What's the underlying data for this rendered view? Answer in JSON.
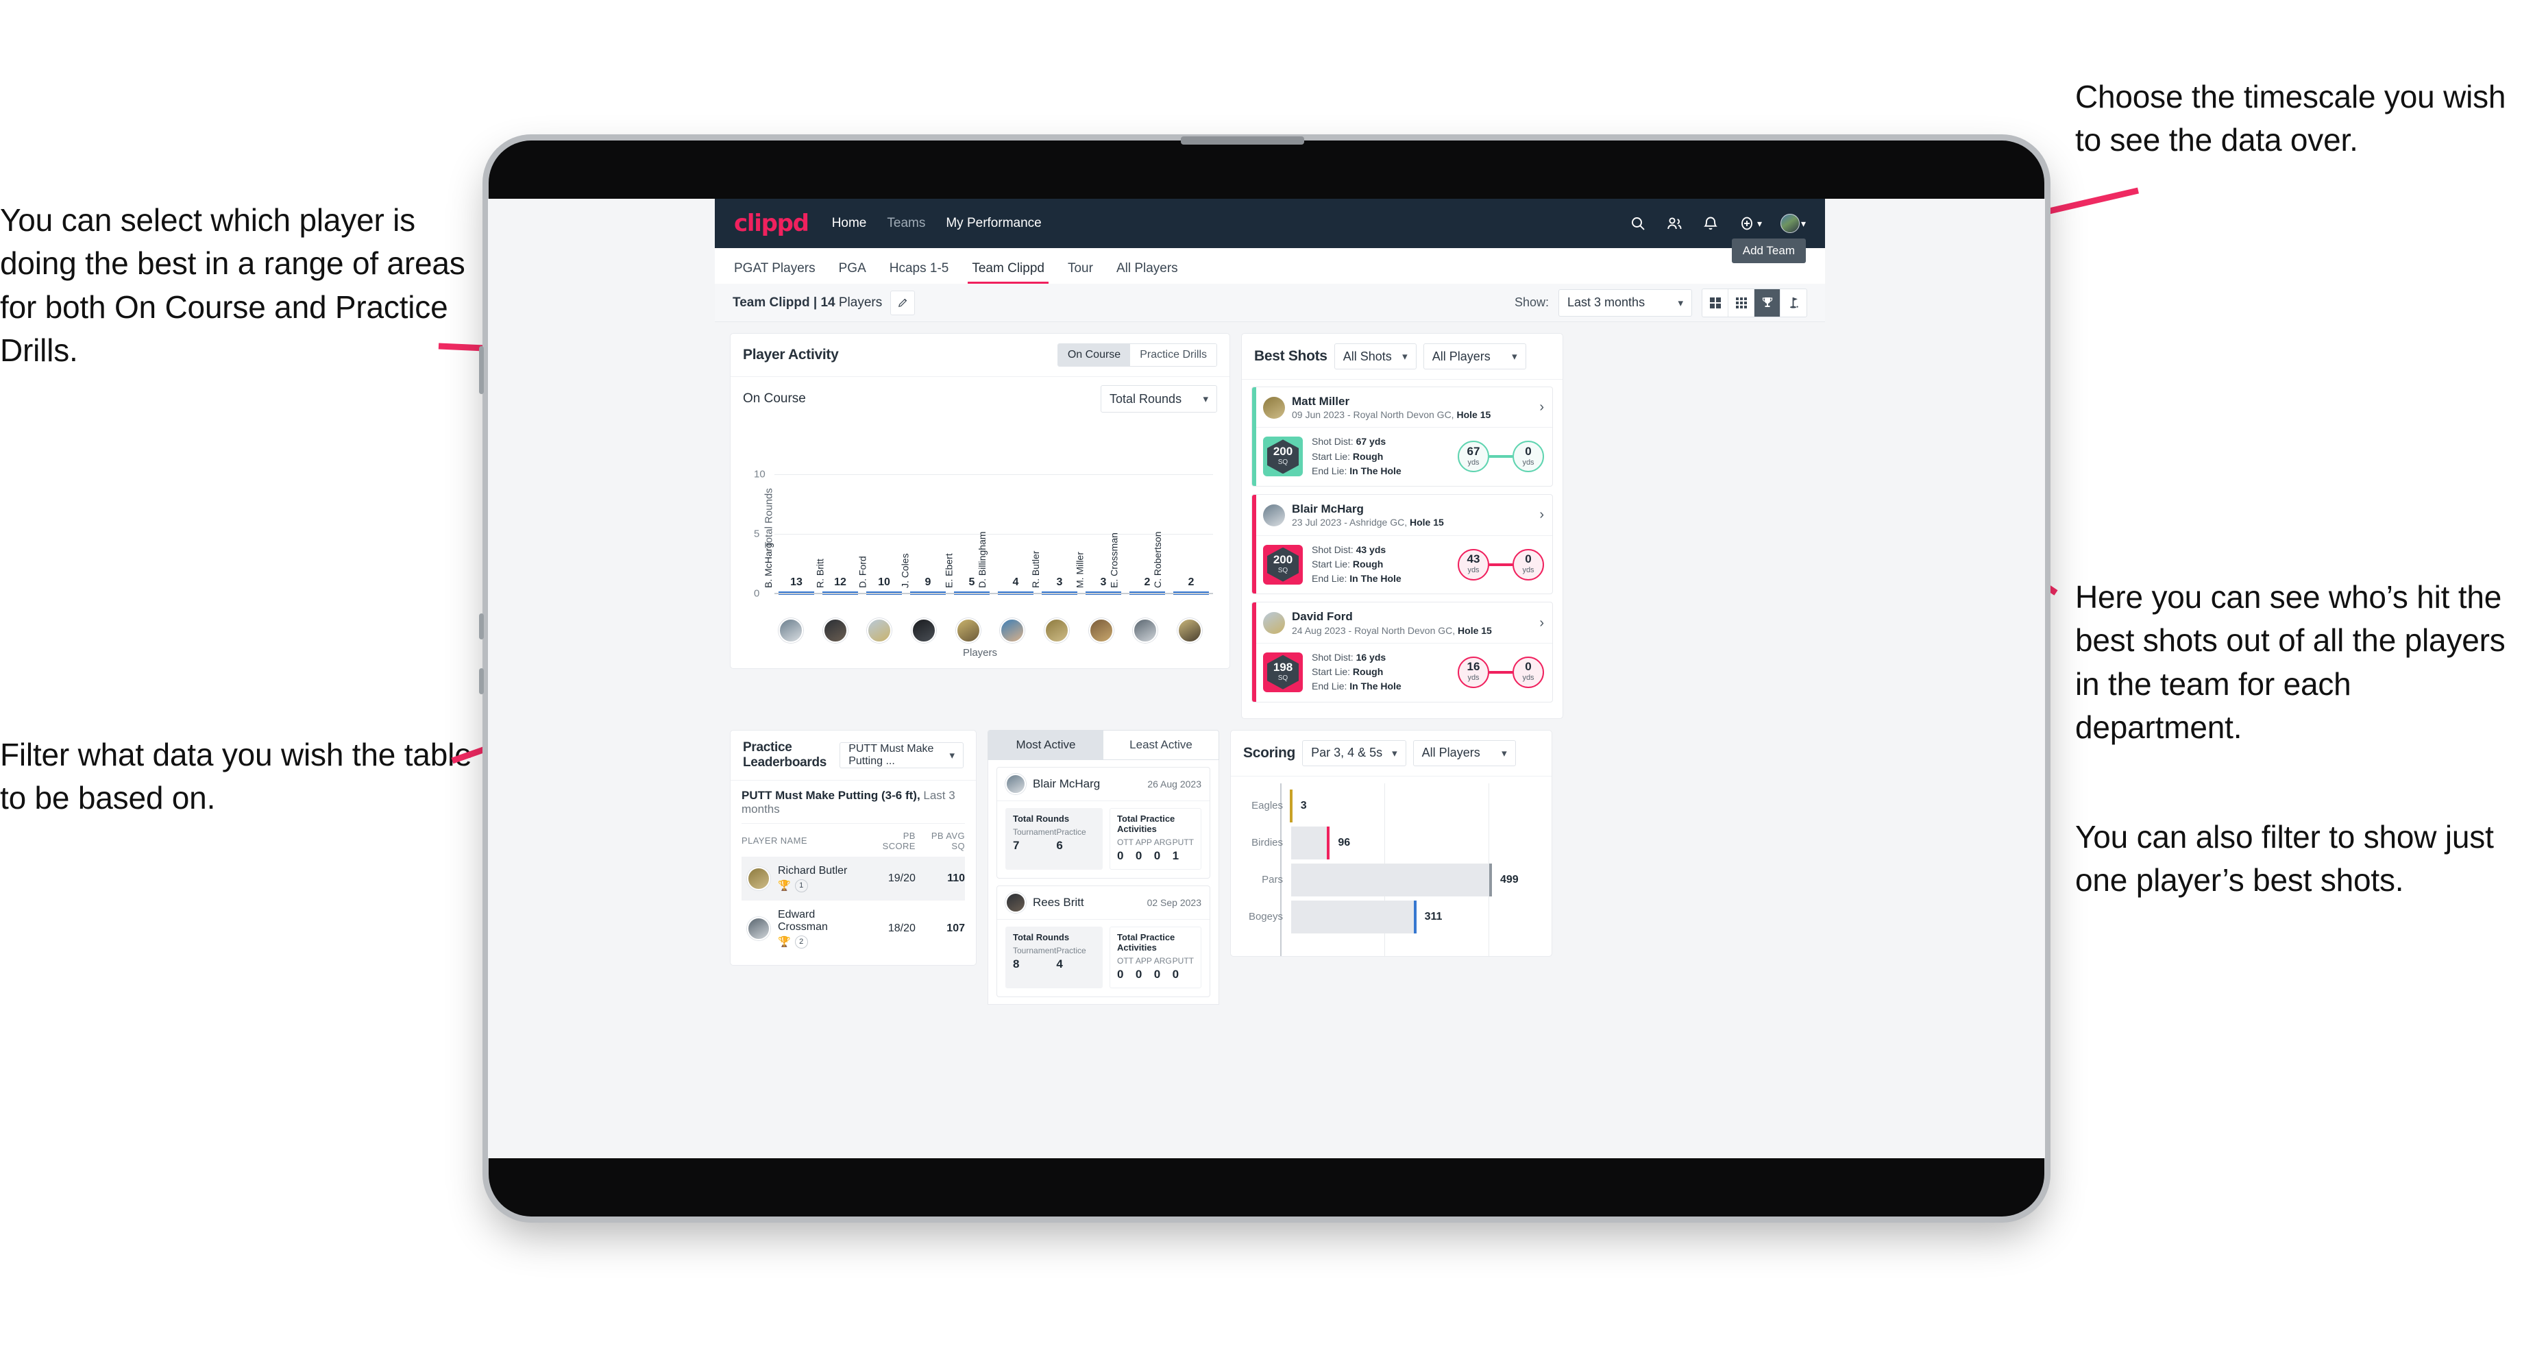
{
  "annotations": {
    "left_top": "You can select which player is doing the best in a range of areas for both On Course and Practice Drills.",
    "left_bottom": "Filter what data you wish the table to be based on.",
    "right_top": "Choose the timescale you wish to see the data over.",
    "right_mid": "Here you can see who’s hit the best shots out of all the players in the team for each department.",
    "right_bottom": "You can also filter to show just one player’s best shots."
  },
  "topnav": {
    "brand": "clippd",
    "links": [
      "Home",
      "Teams",
      "My Performance"
    ],
    "icons": [
      "search-icon",
      "people-icon",
      "bell-icon",
      "plus-circle-icon",
      "avatar"
    ]
  },
  "tabs": {
    "items": [
      "PGAT Players",
      "PGA",
      "Hcaps 1-5",
      "Team Clippd",
      "Tour",
      "All Players"
    ],
    "active": "Team Clippd",
    "add_team_label": "Add Team"
  },
  "subheader": {
    "team_label_bold": "Team Clippd | 14",
    "team_label_rest": " Players",
    "show_label": "Show:",
    "date_range": "Last 3 months",
    "view_buttons": [
      "grid-large-icon",
      "grid-small-icon",
      "trophy-icon",
      "flag-icon"
    ],
    "view_active_index": 2
  },
  "player_activity": {
    "title": "Player Activity",
    "segments": [
      "On Course",
      "Practice Drills"
    ],
    "segment_active": "On Course",
    "sub_label": "On Course",
    "metric": "Total Rounds"
  },
  "best_shots": {
    "title": "Best Shots",
    "filter_shots": "All Shots",
    "filter_players": "All Players",
    "cards": [
      {
        "name": "Matt Miller",
        "meta_plain": "09 Jun 2023 - Royal North Devon GC, ",
        "meta_bold": "Hole 15",
        "hex_num": "200",
        "hex_sub": "SQ",
        "accent": "#5fd4b0",
        "shot_dist_label": "Shot Dist: ",
        "shot_dist_value": "67 yds",
        "start_lie_label": "Start Lie: ",
        "start_lie_value": "Rough",
        "end_lie_label": "End Lie: ",
        "end_lie_value": "In The Hole",
        "from_value": "67",
        "from_unit": "yds",
        "to_value": "0",
        "to_unit": "yds"
      },
      {
        "name": "Blair McHarg",
        "meta_plain": "23 Jul 2023 - Ashridge GC, ",
        "meta_bold": "Hole 15",
        "hex_num": "200",
        "hex_sub": "SQ",
        "accent": "#f0215e",
        "shot_dist_label": "Shot Dist: ",
        "shot_dist_value": "43 yds",
        "start_lie_label": "Start Lie: ",
        "start_lie_value": "Rough",
        "end_lie_label": "End Lie: ",
        "end_lie_value": "In The Hole",
        "from_value": "43",
        "from_unit": "yds",
        "to_value": "0",
        "to_unit": "yds"
      },
      {
        "name": "David Ford",
        "meta_plain": "24 Aug 2023 - Royal North Devon GC, ",
        "meta_bold": "Hole 15",
        "hex_num": "198",
        "hex_sub": "SQ",
        "accent": "#f0215e",
        "shot_dist_label": "Shot Dist: ",
        "shot_dist_value": "16 yds",
        "start_lie_label": "Start Lie: ",
        "start_lie_value": "Rough",
        "end_lie_label": "End Lie: ",
        "end_lie_value": "In The Hole",
        "from_value": "16",
        "from_unit": "yds",
        "to_value": "0",
        "to_unit": "yds"
      }
    ]
  },
  "practice_leaderboards": {
    "title": "Practice Leaderboards",
    "drill_select": "PUTT Must Make Putting ...",
    "subtitle_bold": "PUTT Must Make Putting (3-6 ft),",
    "subtitle_rest": " Last 3 months",
    "columns": [
      "PLAYER NAME",
      "PB SCORE",
      "PB AVG SQ"
    ],
    "rows": [
      {
        "name": "Richard Butler",
        "rank": "1",
        "trophy": "gold",
        "pb_score": "19/20",
        "pb_avg_sq": "110"
      },
      {
        "name": "Edward Crossman",
        "rank": "2",
        "trophy": "silver",
        "pb_score": "18/20",
        "pb_avg_sq": "107"
      }
    ]
  },
  "activity": {
    "tabs": [
      "Most Active",
      "Least Active"
    ],
    "tab_active": "Most Active",
    "rounds_title": "Total Rounds",
    "rounds_cols": [
      "Tournament",
      "Practice"
    ],
    "practice_title": "Total Practice Activities",
    "practice_cols": [
      "OTT",
      "APP",
      "ARG",
      "PUTT"
    ],
    "cards": [
      {
        "name": "Blair McHarg",
        "date": "26 Aug 2023",
        "tournament": "7",
        "practice": "6",
        "ott": "0",
        "app": "0",
        "arg": "0",
        "putt": "1"
      },
      {
        "name": "Rees Britt",
        "date": "02 Sep 2023",
        "tournament": "8",
        "practice": "4",
        "ott": "0",
        "app": "0",
        "arg": "0",
        "putt": "0"
      }
    ]
  },
  "scoring": {
    "title": "Scoring",
    "filter_par": "Par 3, 4 & 5s",
    "filter_players": "All Players"
  },
  "chart_data": [
    {
      "type": "bar",
      "title": "Player Activity — On Course",
      "xlabel": "Players",
      "ylabel": "Total Rounds",
      "ylim": [
        0,
        14
      ],
      "yticks": [
        0,
        5,
        10
      ],
      "grid": true,
      "categories": [
        "B. McHarg",
        "R. Britt",
        "D. Ford",
        "J. Coles",
        "E. Ebert",
        "D. Billingham",
        "R. Butler",
        "M. Miller",
        "E. Crossman",
        "C. Robertson"
      ],
      "values": [
        13,
        12,
        10,
        9,
        5,
        4,
        3,
        3,
        2,
        2
      ],
      "bar_color": "#e6e8ec",
      "cap_color": "#3778d0"
    },
    {
      "type": "bar",
      "orientation": "horizontal",
      "title": "Scoring",
      "categories": [
        "Eagles",
        "Birdies",
        "Pars",
        "Bogeys"
      ],
      "values": [
        3,
        96,
        499,
        311
      ],
      "xlim": [
        0,
        620
      ],
      "grid": true,
      "colors": [
        "#c9a227",
        "#f0215e",
        "#8f979f",
        "#3778d0"
      ],
      "track_color": "#e6e8ec"
    }
  ]
}
